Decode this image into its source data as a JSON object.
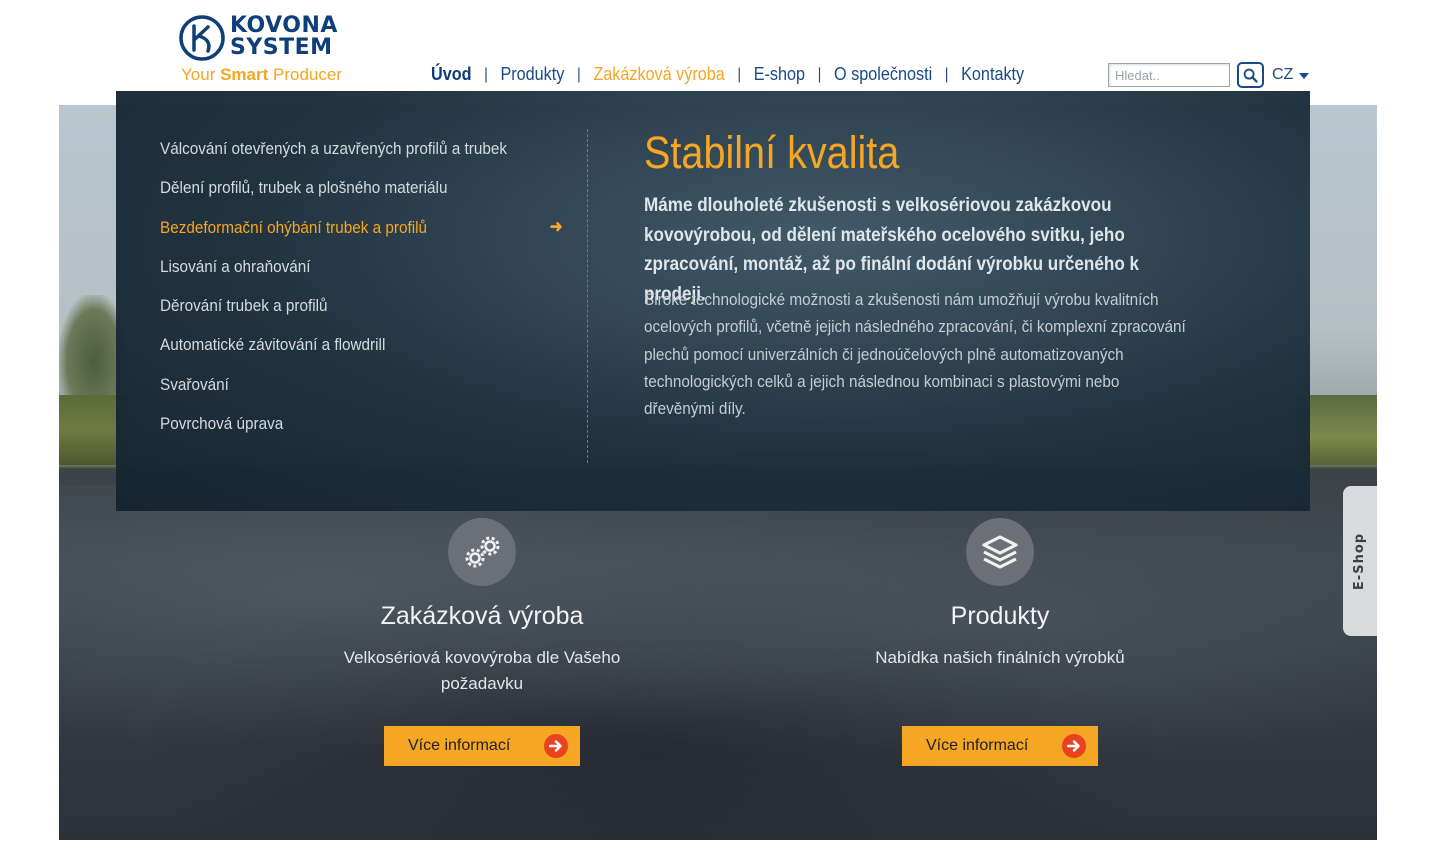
{
  "logo": {
    "name_line1": "KOVONA",
    "name_line2": "SYSTEM",
    "tagline_prefix": "Your ",
    "tagline_bold": "Smart",
    "tagline_suffix": " Producer"
  },
  "nav": {
    "items": [
      {
        "label": "Úvod"
      },
      {
        "label": "Produkty"
      },
      {
        "label": "Zakázková výroba"
      },
      {
        "label": "E-shop"
      },
      {
        "label": "O společnosti"
      },
      {
        "label": "Kontakty"
      }
    ],
    "separator": "|"
  },
  "search": {
    "placeholder": "Hledat.."
  },
  "lang": {
    "current": "CZ"
  },
  "submenu": {
    "items": [
      {
        "label": "Válcování otevřených a uzavřených profilů a trubek"
      },
      {
        "label": "Dělení profilů, trubek a plošného materiálu"
      },
      {
        "label": "Bezdeformační ohýbání trubek a profilů"
      },
      {
        "label": "Lisování a ohraňování"
      },
      {
        "label": "Děrování trubek a profilů"
      },
      {
        "label": "Automatické závitování a flowdrill"
      },
      {
        "label": "Svařování"
      },
      {
        "label": "Povrchová úprava"
      }
    ],
    "active_arrow": "➜"
  },
  "panel": {
    "title": "Stabilní kvalita",
    "lead": "Máme dlouholeté zkušenosti s velkosériovou zakázkovou kovovýrobou, od dělení mateřského ocelového svitku, jeho zpracování, montáž, až po finální dodání výrobku určeného k prodeji.",
    "text": "Široké technologické možnosti a zkušenosti nám umožňují výrobu kvalitních ocelových profilů, včetně jejich následného zpracování, či komplexní zpracování plechů pomocí univerzálních či jednoúčelových plně automatizovaných technologických celků a jejich následnou kombinaci s plastovými nebo dřevěnými díly."
  },
  "features": [
    {
      "icon": "gears-icon",
      "title": "Zakázková výroba",
      "description": "Velkosériová kovovýroba dle Vašeho požadavku",
      "button": "Více informací"
    },
    {
      "icon": "layers-icon",
      "title": "Produkty",
      "description": "Nabídka našich finálních výrobků",
      "button": "Více informací"
    }
  ],
  "eshop_tab": {
    "label": "E-Shop"
  },
  "colors": {
    "brand_blue": "#0f3f78",
    "accent_orange": "#f5a623",
    "arrow_red": "#e8431f",
    "panel_dark": "#1c2d3a"
  }
}
